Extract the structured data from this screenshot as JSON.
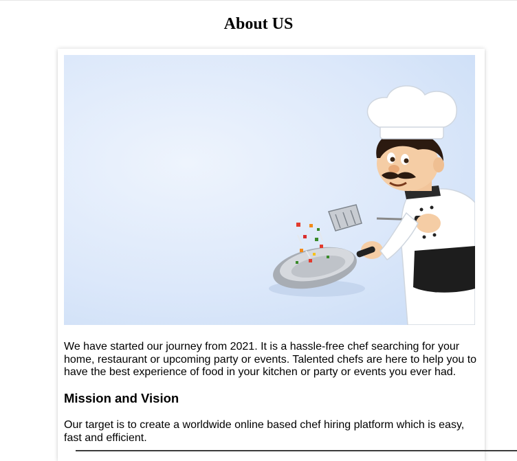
{
  "page": {
    "title": "About US"
  },
  "hero": {
    "icon": "chef-cooking-illustration",
    "background_color": "#dce8fa"
  },
  "intro": {
    "text": "We have started our journey from 2021. It is a hassle-free chef searching for your home, restaurant or upcoming party or events. Talented chefs are here to help you to have the best experience of food in your kitchen or party or events you ever had."
  },
  "mission": {
    "heading": "Mission and Vision",
    "text": "Our target is to create a worldwide online based chef hiring platform which is easy, fast and efficient."
  }
}
